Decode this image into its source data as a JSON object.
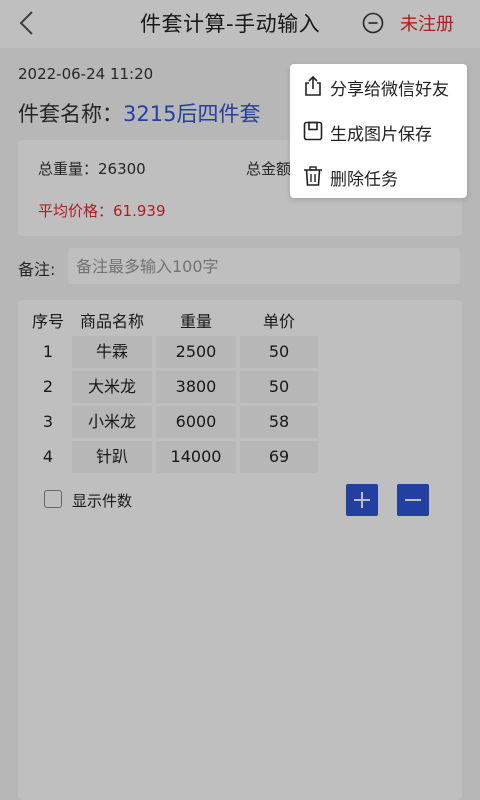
{
  "header": {
    "title": "件套计算-手动输入",
    "unregistered": "未注册"
  },
  "record": {
    "datetime": "2022-06-24 11:20",
    "set_name_label": "件套名称：",
    "set_name_value": "3215后四件套"
  },
  "summary": {
    "total_weight": "总重量：26300",
    "total_amount": "总金额",
    "avg_price": "平均价格：61.939"
  },
  "remark": {
    "label": "备注:",
    "placeholder": "备注最多输入100字"
  },
  "table": {
    "headers": [
      "序号",
      "商品名称",
      "重量",
      "单价"
    ],
    "rows": [
      {
        "idx": "1",
        "name": "牛霖",
        "weight": "2500",
        "price": "50"
      },
      {
        "idx": "2",
        "name": "大米龙",
        "weight": "3800",
        "price": "50"
      },
      {
        "idx": "3",
        "name": "小米龙",
        "weight": "6000",
        "price": "58"
      },
      {
        "idx": "4",
        "name": "针趴",
        "weight": "14000",
        "price": "69"
      }
    ]
  },
  "options": {
    "show_count_label": "显示件数",
    "show_count_checked": false
  },
  "menu": {
    "items": [
      {
        "label": "分享给微信好友",
        "icon": "share-icon"
      },
      {
        "label": "生成图片保存",
        "icon": "save-icon"
      },
      {
        "label": "删除任务",
        "icon": "trash-icon"
      }
    ]
  },
  "colors": {
    "accent": "#2f54d6",
    "danger": "#e22b2b"
  }
}
